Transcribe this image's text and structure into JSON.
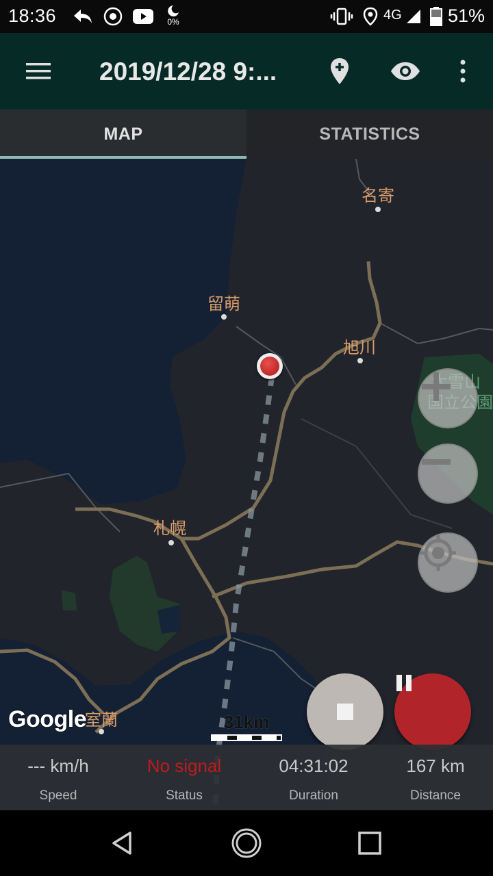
{
  "status_bar": {
    "time": "18:36",
    "icons": [
      "reply-arrow-icon",
      "record-icon",
      "youtube-icon",
      "data-saver-icon",
      "vibrate-icon",
      "location-icon",
      "signal-icon",
      "battery-icon"
    ],
    "data_percent": "0%",
    "network": "4G",
    "battery": "51%"
  },
  "app_bar": {
    "title": "2019/12/28 9:...",
    "icons": [
      "menu-icon",
      "add-marker-icon",
      "eye-icon",
      "more-vert-icon"
    ],
    "color": "#062b27"
  },
  "tabs": [
    {
      "label": "MAP",
      "selected": true
    },
    {
      "label": "STATISTICS",
      "selected": false
    }
  ],
  "map": {
    "places": [
      "名寄",
      "留萌",
      "旭川",
      "大雪山",
      "国立公園",
      "札幌",
      "室蘭"
    ],
    "attribution": "Google",
    "scale_label": "31km",
    "controls": [
      "zoom-in-icon",
      "zoom-out-icon",
      "my-location-icon"
    ],
    "label_color": "#d99b6b"
  },
  "fabs": [
    {
      "name": "stop",
      "icon": "stop-icon",
      "color": "#bdb8b4"
    },
    {
      "name": "pause",
      "icon": "pause-icon",
      "color": "#b0242a"
    }
  ],
  "stats": [
    {
      "value": "--- km/h",
      "label": "Speed"
    },
    {
      "value": "No signal",
      "label": "Status",
      "status_color": "#c11a1a"
    },
    {
      "value": "04:31:02",
      "label": "Duration"
    },
    {
      "value": "167 km",
      "label": "Distance"
    }
  ],
  "nav_bar": {
    "buttons": [
      "back-icon",
      "home-icon",
      "recents-icon"
    ]
  }
}
